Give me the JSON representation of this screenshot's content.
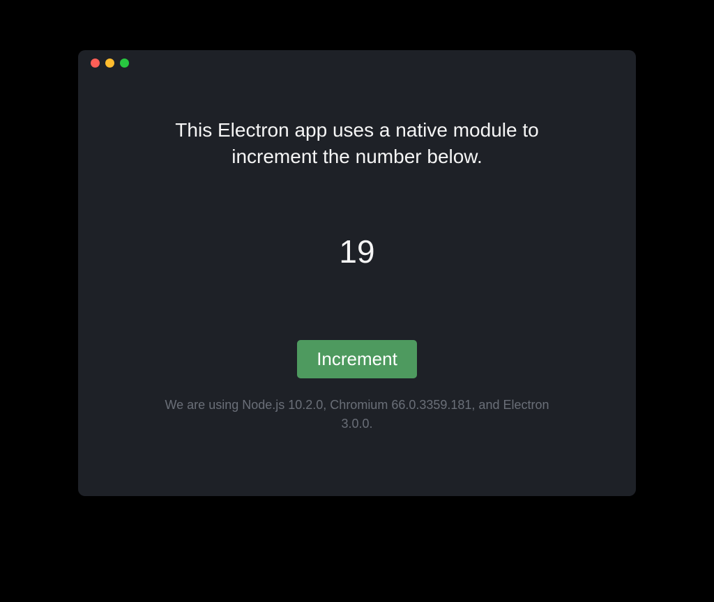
{
  "window": {
    "heading": "This Electron app uses a native module to increment the number below.",
    "counter_value": "19",
    "button_label": "Increment",
    "footer_text": "We are using Node.js 10.2.0, Chromium 66.0.3359.181, and Electron 3.0.0."
  }
}
